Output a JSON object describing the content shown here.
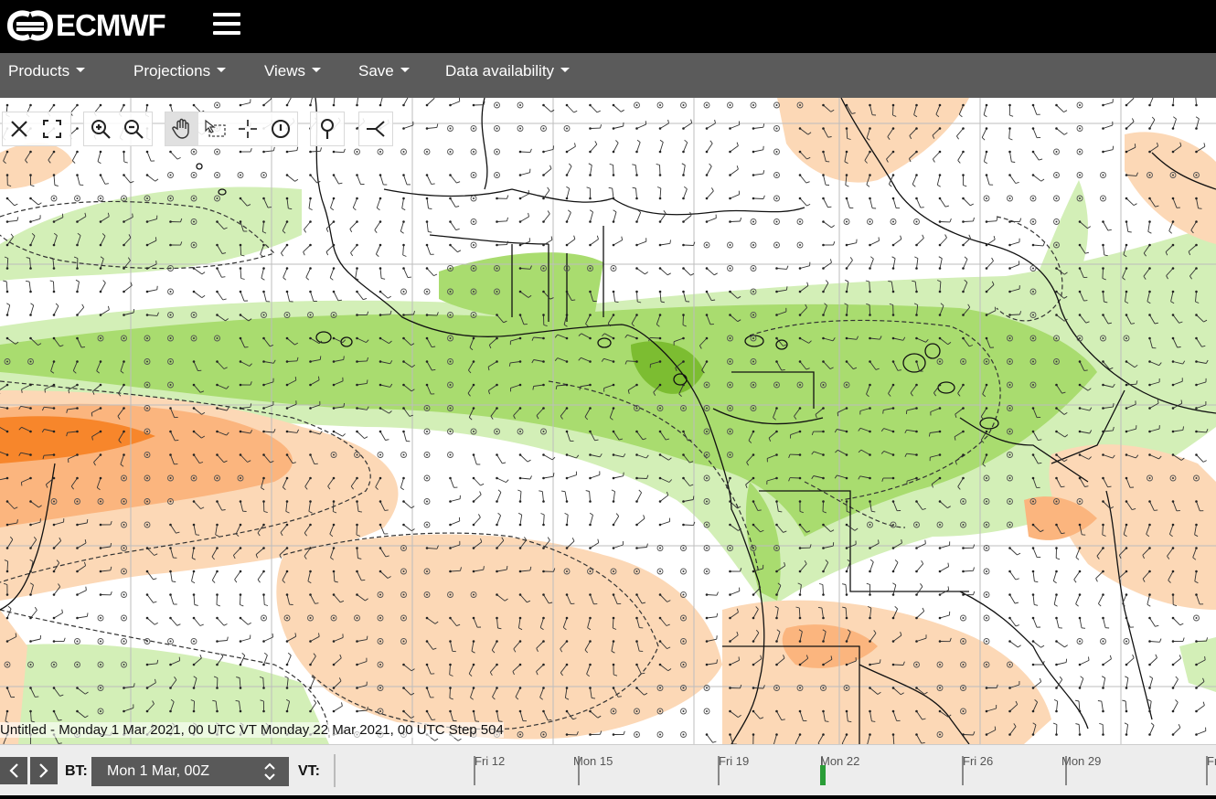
{
  "header": {
    "logo_text": "ECMWF",
    "logo_icon": "ecmwf-logo-icon",
    "menu_icon": "hamburger-icon"
  },
  "menubar": {
    "items": [
      {
        "label": "Products"
      },
      {
        "label": "Projections"
      },
      {
        "label": "Views"
      },
      {
        "label": "Save"
      },
      {
        "label": "Data availability"
      }
    ]
  },
  "map_tools": [
    "close-icon",
    "fullscreen-icon",
    "zoom-in-icon",
    "zoom-out-icon",
    "pan-hand-icon",
    "box-select-icon",
    "crosshair-icon",
    "info-icon",
    "location-pin-icon",
    "branch-icon"
  ],
  "map": {
    "caption": "Untitled - Monday 1 Mar 2021, 00 UTC VT Monday 22 Mar 2021, 00 UTC Step 504",
    "colors": {
      "light_green": "#d3efb7",
      "mid_green": "#a9dc6f",
      "dark_green": "#7cbd31",
      "light_orange": "#fcd8b6",
      "mid_orange": "#fbb57e",
      "dark_orange": "#f7862b"
    }
  },
  "timeline": {
    "bt_label": "BT:",
    "bt_value": "Mon 1 Mar, 00Z",
    "vt_label": "VT:",
    "dates": [
      "Fri 12",
      "Mon 15",
      "Fri 19",
      "Mon 22",
      "Fri 26",
      "Mon 29",
      "Fr"
    ],
    "accent": "#2a9d37"
  }
}
